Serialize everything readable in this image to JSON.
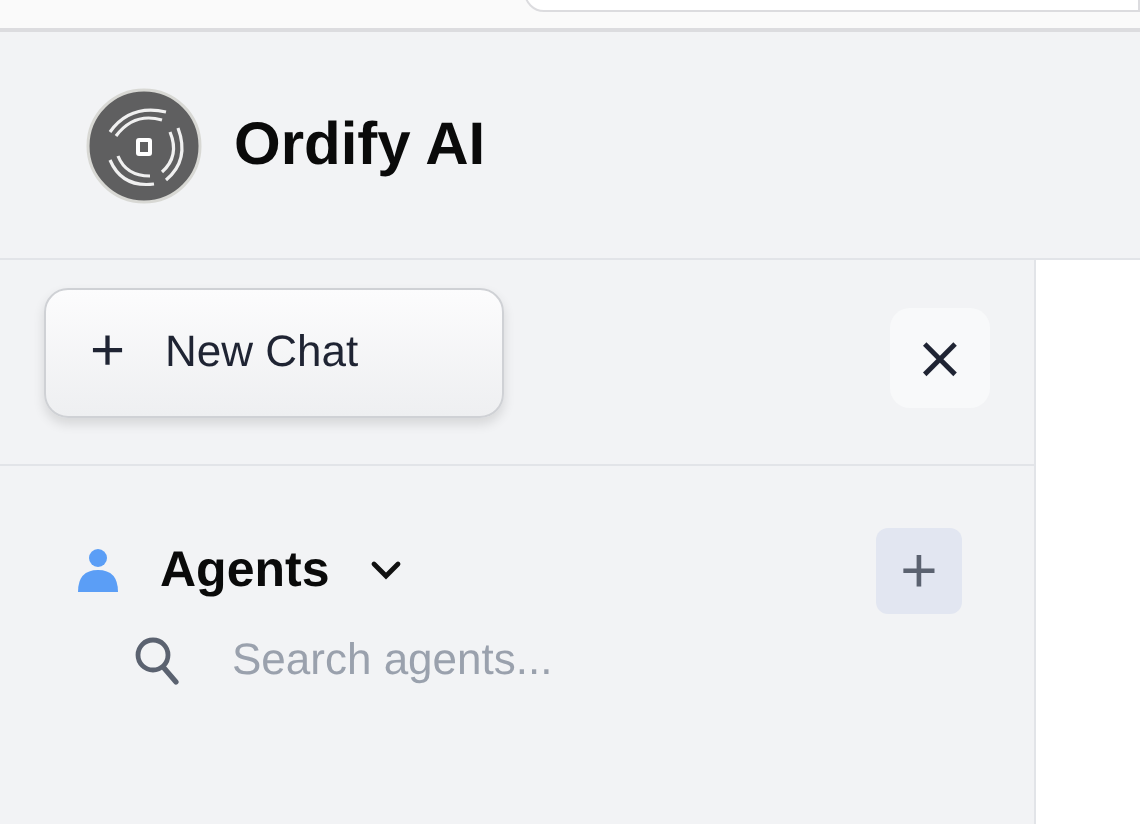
{
  "app": {
    "title": "Ordify AI"
  },
  "sidebar": {
    "new_chat": {
      "icon": "+",
      "label": "New Chat"
    },
    "close": {
      "icon": "×"
    },
    "agents": {
      "label": "Agents",
      "expanded": true,
      "add": "+"
    },
    "search": {
      "placeholder": "Search agents..."
    }
  }
}
